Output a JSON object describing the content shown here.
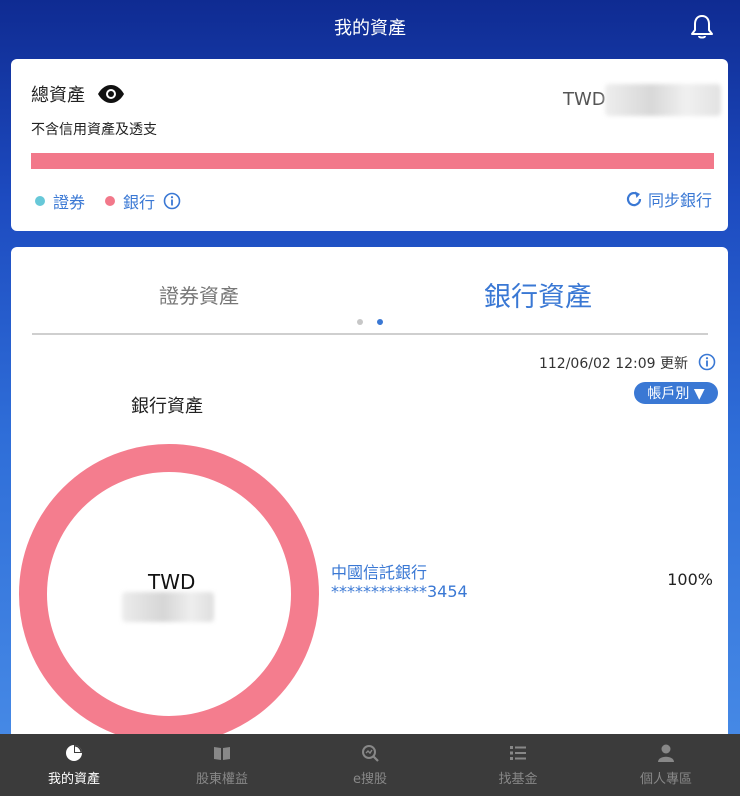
{
  "header": {
    "title": "我的資產"
  },
  "summary": {
    "total_label": "總資產",
    "exclusion_note": "不含信用資產及透支",
    "currency": "TWD",
    "legend": [
      {
        "label": "證券",
        "color": "#67c8d8"
      },
      {
        "label": "銀行",
        "color": "#f2788a"
      }
    ],
    "sync_label": "同步銀行",
    "bank_share": 1.0
  },
  "assets": {
    "tabs": [
      {
        "label": "證券資產",
        "active": false
      },
      {
        "label": "銀行資產",
        "active": true
      }
    ],
    "updated_text": "112/06/02 12:09 更新",
    "account_filter": "帳戶別 ▼",
    "section_title": "銀行資產",
    "donut_currency": "TWD",
    "banks": [
      {
        "name": "中國信託銀行",
        "account": "************3454",
        "percent": "100%"
      }
    ],
    "donut_color": "#f47d8e"
  },
  "nav": [
    {
      "label": "我的資產",
      "icon": "pie-chart-icon",
      "active": true
    },
    {
      "label": "股東權益",
      "icon": "book-icon",
      "active": false
    },
    {
      "label": "e搜股",
      "icon": "search-stock-icon",
      "active": false
    },
    {
      "label": "找基金",
      "icon": "list-icon",
      "active": false
    },
    {
      "label": "個人專區",
      "icon": "person-icon",
      "active": false
    }
  ]
}
